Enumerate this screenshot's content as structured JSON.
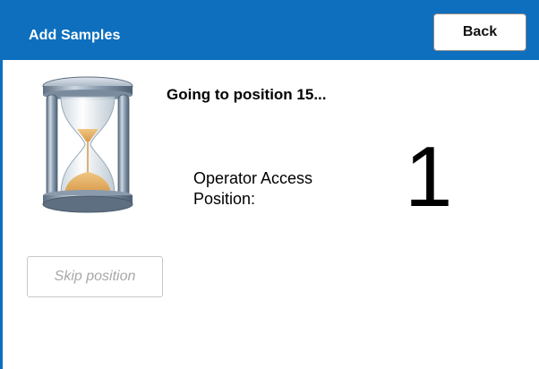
{
  "header": {
    "title": "Add Samples",
    "back_label": "Back"
  },
  "status": {
    "message": "Going to position 15...",
    "icon": "hourglass-icon"
  },
  "access": {
    "label_line1": "Operator Access",
    "label_line2": "Position:",
    "value": "1"
  },
  "actions": {
    "skip_label": "Skip position",
    "skip_enabled": false
  },
  "colors": {
    "header_bg": "#0e6fbe",
    "header_text": "#ffffff",
    "disabled_text": "#a8a8a8"
  }
}
